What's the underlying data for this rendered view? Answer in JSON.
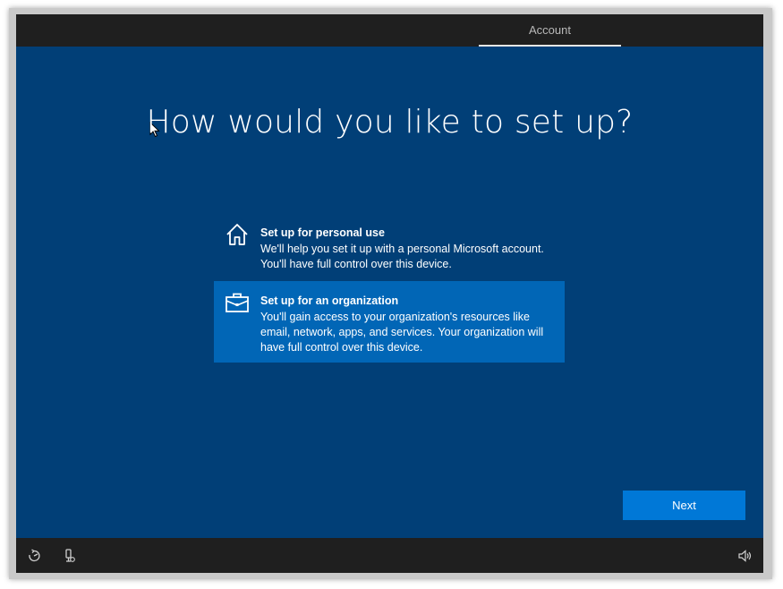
{
  "header": {
    "tabs": [
      {
        "label": "Account",
        "active": true
      }
    ]
  },
  "main": {
    "title": "How would you like to set up?",
    "options": [
      {
        "icon": "home-icon",
        "heading": "Set up for personal use",
        "description": "We'll help you set it up with a personal Microsoft account. You'll have full control over this device.",
        "selected": false
      },
      {
        "icon": "briefcase-icon",
        "heading": "Set up for an organization",
        "description": "You'll gain access to your organization's resources like email, network, apps, and services. Your organization will have full control over this device.",
        "selected": true
      }
    ],
    "next_label": "Next"
  },
  "footer": {
    "icons": [
      "ease-of-access-icon",
      "microphone-icon",
      "volume-icon"
    ]
  },
  "colors": {
    "background": "#013f77",
    "bar": "#1f1f1f",
    "selected_option": "#0166b6",
    "accent_button": "#0078d7"
  }
}
